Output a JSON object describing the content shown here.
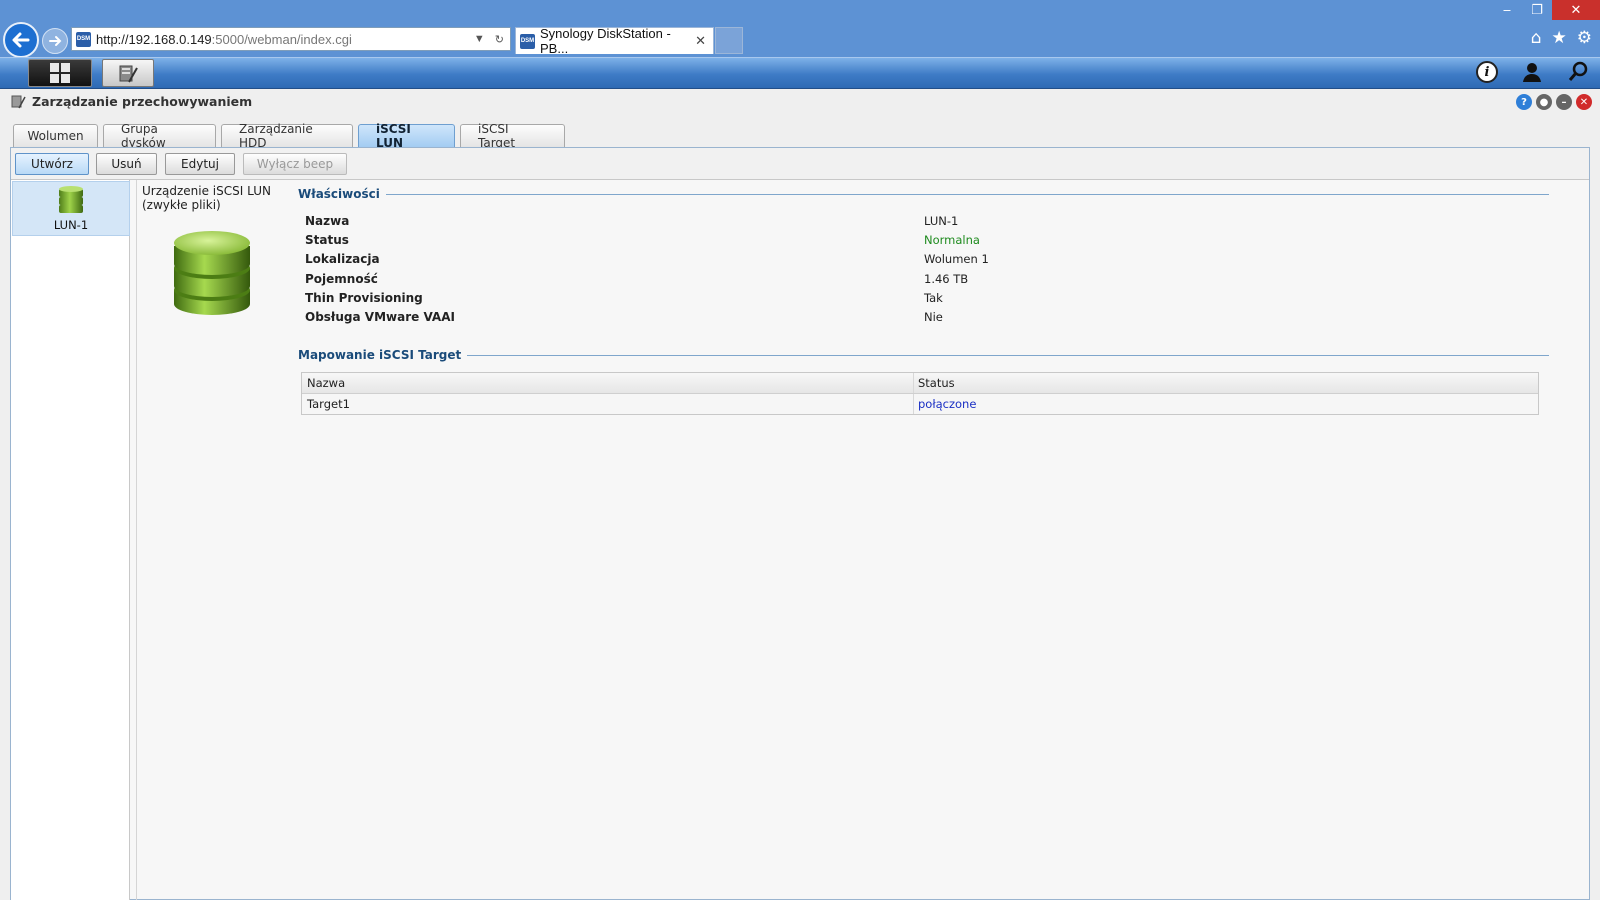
{
  "browser": {
    "url_host": "http://192.168.0.149",
    "url_rest": ":5000/webman/index.cgi",
    "tab_title": "Synology DiskStation - PB...",
    "tab_close": "✕",
    "favicon_text": "DSM"
  },
  "window": {
    "title": "Zarządzanie przechowywaniem"
  },
  "tabs": [
    {
      "label": "Wolumen"
    },
    {
      "label": "Grupa dysków"
    },
    {
      "label": "Zarządzanie HDD"
    },
    {
      "label": "iSCSI LUN"
    },
    {
      "label": "iSCSI Target"
    }
  ],
  "toolbar": {
    "create": "Utwórz",
    "delete": "Usuń",
    "edit": "Edytuj",
    "beep_off": "Wyłącz beep"
  },
  "lun_list": {
    "items": [
      {
        "label": "LUN-1"
      }
    ]
  },
  "detail": {
    "device_type_line1": "Urządzenie iSCSI LUN",
    "device_type_line2": "(zwykłe pliki)",
    "properties_title": "Właściwości",
    "properties": [
      {
        "key": "Nazwa",
        "value": "LUN-1"
      },
      {
        "key": "Status",
        "value": "Normalna"
      },
      {
        "key": "Lokalizacja",
        "value": "Wolumen 1"
      },
      {
        "key": "Pojemność",
        "value": "1.46 TB"
      },
      {
        "key": "Thin Provisioning",
        "value": "Tak"
      },
      {
        "key": "Obsługa VMware VAAI",
        "value": "Nie"
      }
    ],
    "mapping_title": "Mapowanie iSCSI Target",
    "mapping_headers": {
      "name": "Nazwa",
      "status": "Status"
    },
    "mapping_rows": [
      {
        "name": "Target1",
        "status": "połączone"
      }
    ]
  },
  "colors": {
    "status_ok": "#1e8b1e",
    "link": "#1a2fc4",
    "section_title": "#1a4b7a"
  }
}
